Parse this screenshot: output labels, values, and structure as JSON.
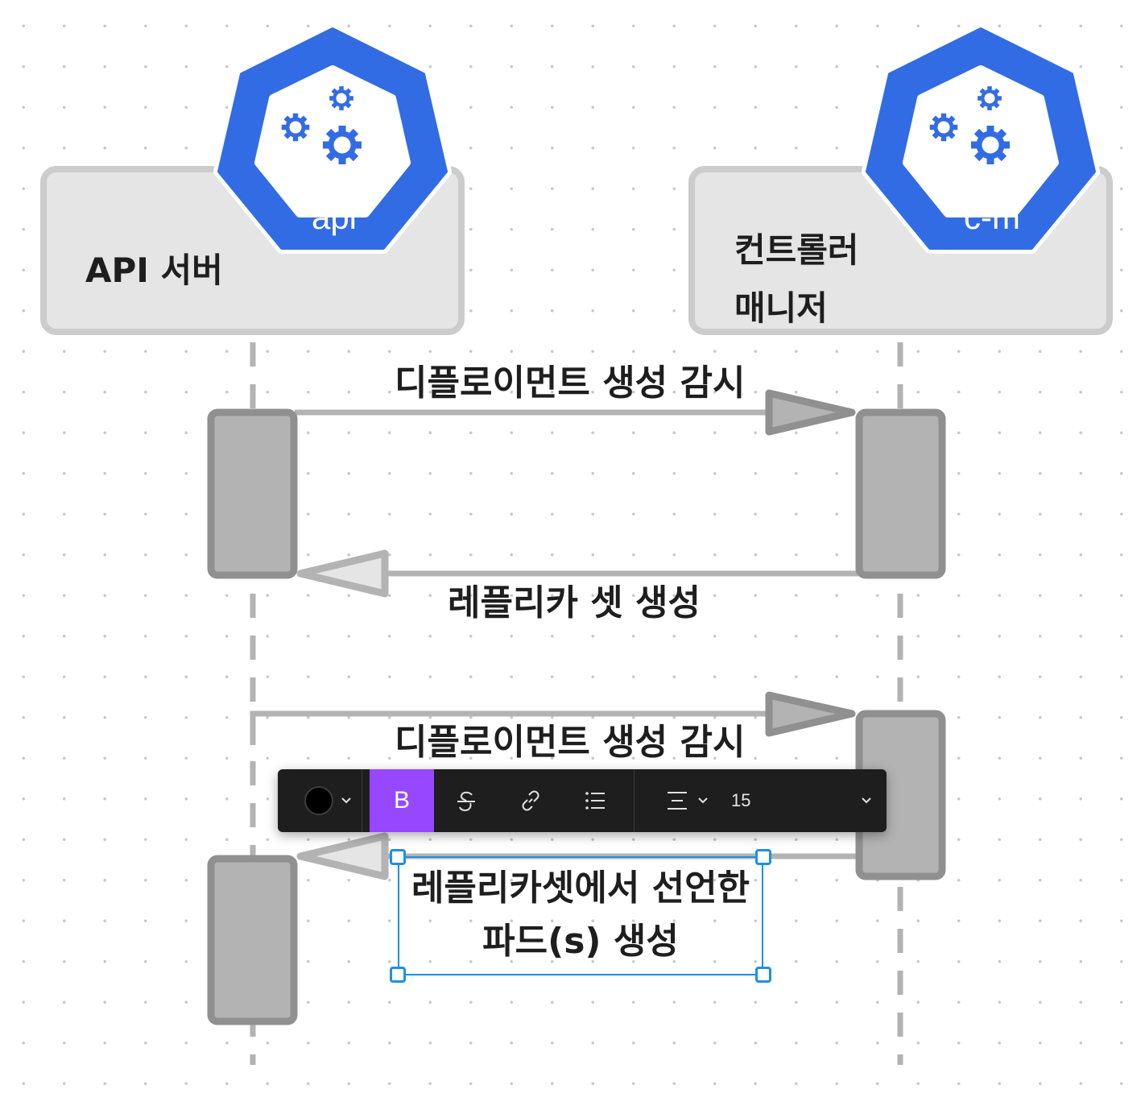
{
  "participants": [
    {
      "label": "API 서버",
      "badge": "api"
    },
    {
      "label_lines": [
        "컨트롤러",
        "매니저"
      ],
      "badge": "c-m"
    }
  ],
  "messages": [
    "디플로이먼트 생성 감시",
    "레플리카 셋 생성",
    "디플로이먼트 생성 감시"
  ],
  "selected_text": {
    "lines": [
      "레플리카셋에서 선언한",
      "파드(s) 생성"
    ]
  },
  "toolbar": {
    "color_value": "#000000",
    "bold_label": "B",
    "font_size": "15"
  },
  "colors": {
    "kubernetes_blue": "#326ce5",
    "box_fill": "#e5e5e5",
    "box_stroke": "#cccccc",
    "activation_fill": "#b3b3b3",
    "activation_stroke": "#909090",
    "toolbar_bg": "#1e1e1e",
    "bold_active": "#9747ff",
    "selection": "#1d8fe8"
  },
  "icons": [
    "gears-icon",
    "strikethrough-icon",
    "link-icon",
    "list-icon",
    "align-center-icon",
    "chevron-down-icon"
  ]
}
